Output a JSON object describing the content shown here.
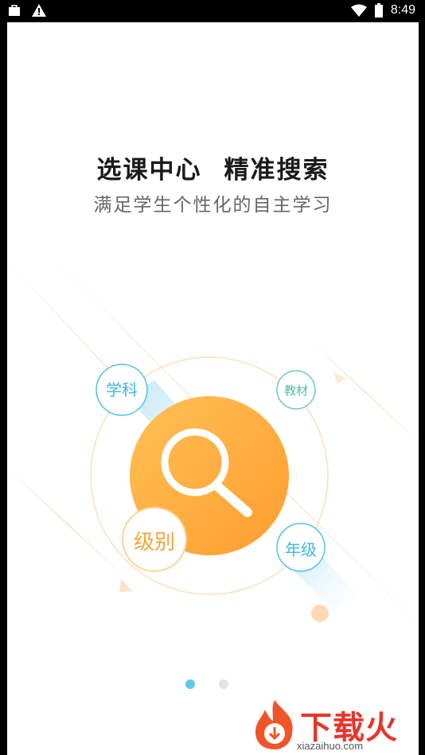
{
  "status_bar": {
    "time": "8:49"
  },
  "headline": {
    "part1": "选课中心",
    "part2": "精准搜索"
  },
  "subtitle": "满足学生个性化的自主学习",
  "tags": {
    "subject": "学科",
    "textbook": "教材",
    "level": "级别",
    "grade": "年级"
  },
  "pager": {
    "total": 2,
    "active": 1
  },
  "watermark": {
    "brand": "下载火",
    "url": "xiazaihuo.com"
  },
  "colors": {
    "accent_orange": "#ffaa33",
    "accent_blue": "#3fb8e6",
    "accent_green": "#4cc39a",
    "dot_active": "#5ccaf3"
  }
}
